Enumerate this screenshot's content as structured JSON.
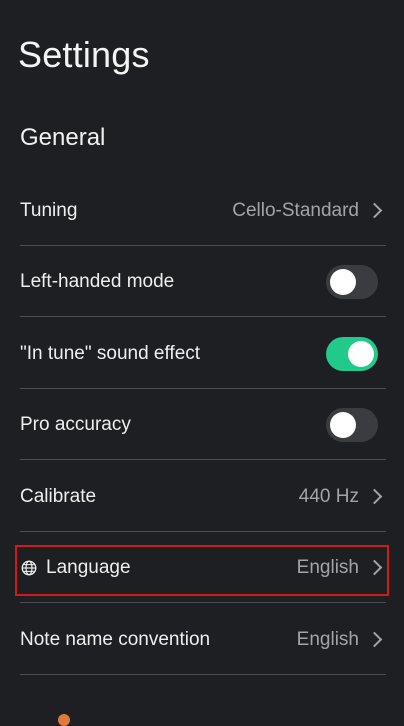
{
  "header": {
    "title": "Settings"
  },
  "sections": {
    "general": {
      "title": "General"
    }
  },
  "settings": {
    "tuning": {
      "label": "Tuning",
      "value": "Cello-Standard"
    },
    "left_handed": {
      "label": "Left-handed mode",
      "enabled": false
    },
    "in_tune_sound": {
      "label": "\"In tune\" sound effect",
      "enabled": true
    },
    "pro_accuracy": {
      "label": "Pro accuracy",
      "enabled": false
    },
    "calibrate": {
      "label": "Calibrate",
      "value": "440 Hz"
    },
    "language": {
      "label": "Language",
      "value": "English"
    },
    "note_name_convention": {
      "label": "Note name convention",
      "value": "English"
    }
  },
  "colors": {
    "background": "#1d1f22",
    "toggle_on": "#21c98b",
    "toggle_off": "#3a3c40",
    "highlight": "#d11a1a"
  },
  "icons": {
    "language": "globe-icon",
    "disclosure": "chevron-right-icon"
  }
}
